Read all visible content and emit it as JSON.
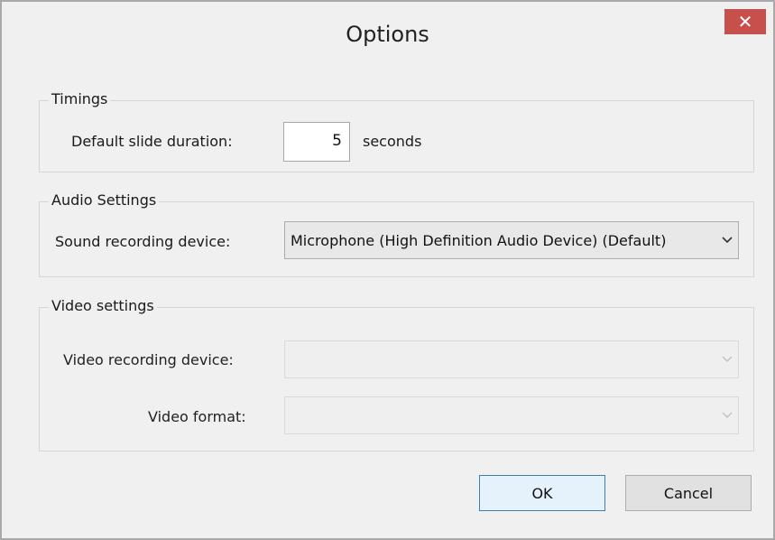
{
  "window": {
    "title": "Options",
    "close_glyph": "✕"
  },
  "timings": {
    "legend": "Timings",
    "duration_label": "Default slide duration:",
    "duration_value": "5",
    "duration_unit": "seconds"
  },
  "audio": {
    "legend": "Audio Settings",
    "device_label": "Sound recording device:",
    "device_value": "Microphone (High Definition Audio Device) (Default)"
  },
  "video": {
    "legend": "Video settings",
    "device_label": "Video recording device:",
    "device_value": "",
    "format_label": "Video format:",
    "format_value": ""
  },
  "buttons": {
    "ok": "OK",
    "cancel": "Cancel"
  },
  "icons": {
    "chevron": "chevron-down-icon",
    "close": "close-icon"
  },
  "colors": {
    "close_button": "#c7504c",
    "default_button_border": "#3c7fb1"
  }
}
